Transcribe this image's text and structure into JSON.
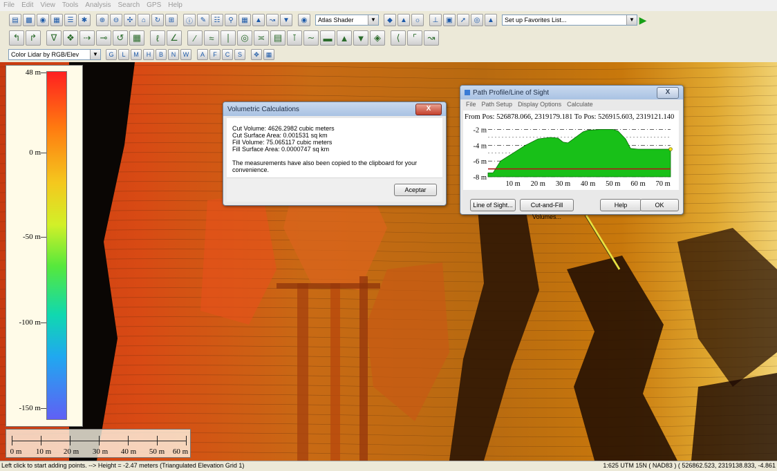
{
  "menu": [
    "File",
    "Edit",
    "View",
    "Tools",
    "Analysis",
    "Search",
    "GPS",
    "Help"
  ],
  "toolbar": {
    "shader_select": "Atlas Shader",
    "favorites_select": "Set up Favorites List...",
    "layer_select": "Color Lidar by RGB/Elev"
  },
  "legend": {
    "labels": [
      "48 m",
      "0 m",
      "-50 m",
      "-100 m",
      "-150 m"
    ],
    "colors": [
      "#ff2020",
      "#f4c81e",
      "#56e83c",
      "#20a8f0",
      "#6060f4"
    ]
  },
  "scale_bar": {
    "labels": [
      "0 m",
      "10 m",
      "20 m",
      "30 m",
      "40 m",
      "50 m",
      "60 m"
    ]
  },
  "volumetric_dialog": {
    "title": "Volumetric Calculations",
    "close": "X",
    "lines": [
      "Cut Volume: 4626.2982 cubic meters",
      "Cut Surface Area: 0.001531 sq km",
      "Fill Volume: 75.065117 cubic meters",
      "Fill Surface Area: 0.0000747 sq km"
    ],
    "note": "The measurements have also been copied to the clipboard for your convenience.",
    "accept": "Aceptar"
  },
  "profile_dialog": {
    "title": "Path Profile/Line of Sight",
    "close": "X",
    "menu": [
      "File",
      "Path Setup",
      "Display Options",
      "Calculate"
    ],
    "positions": "From Pos: 526878.066, 2319179.181  To Pos: 526915.603, 2319121.140",
    "buttons": {
      "line_of_sight": "Line of Sight...",
      "cut_fill": "Cut-and-Fill Volumes...",
      "help": "Help",
      "ok": "OK"
    }
  },
  "chart_data": {
    "type": "area",
    "ylabels": [
      "-2 m",
      "-4 m",
      "-6 m",
      "-8 m"
    ],
    "xlabels": [
      "10 m",
      "20 m",
      "30 m",
      "40 m",
      "50 m",
      "60 m",
      "70 m"
    ],
    "ylim": [
      -8,
      -1.7
    ],
    "xlim": [
      0,
      73
    ],
    "profile": {
      "x": [
        0,
        2,
        5,
        10,
        15,
        20,
        25,
        28,
        30,
        32,
        35,
        38,
        40,
        45,
        50,
        52,
        55,
        57,
        60,
        65,
        70,
        73
      ],
      "y": [
        -7.5,
        -7.5,
        -6.0,
        -5.0,
        -4.0,
        -3.2,
        -3.0,
        -3.1,
        -3.6,
        -3.7,
        -3.0,
        -2.3,
        -2.1,
        -2.0,
        -2.0,
        -2.2,
        -3.2,
        -4.4,
        -4.5,
        -4.5,
        -4.5,
        -4.5
      ]
    },
    "cut_fill_line": {
      "x": [
        0,
        73
      ],
      "y": [
        -7.0,
        -7.0
      ]
    },
    "fill_color": "#18c018",
    "line_color": "#b01818"
  },
  "status": {
    "left": "Left click to start adding points. --> Height = -2.47 meters (Triangulated Elevation Grid 1)",
    "right": "1:625  UTM 15N ( NAD83 ) ( 526862.523, 2319138.833, -4.861"
  }
}
